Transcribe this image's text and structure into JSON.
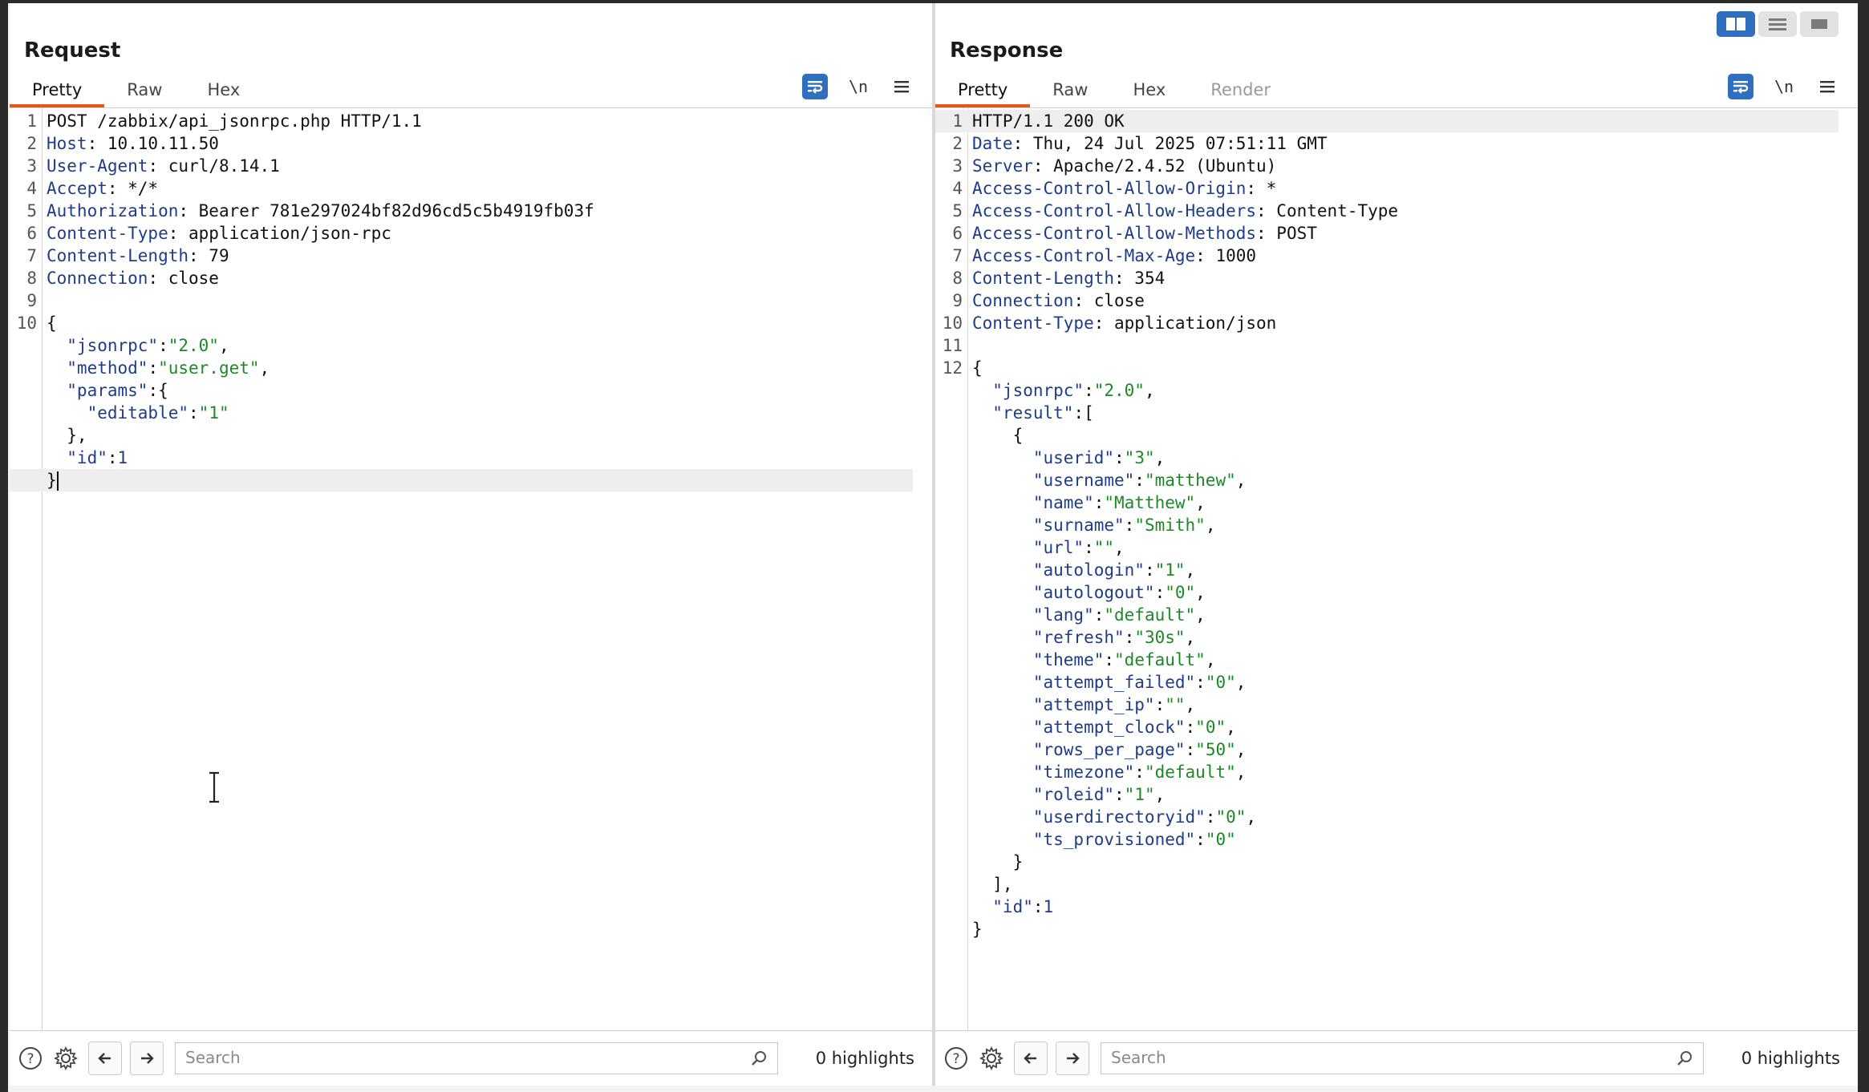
{
  "layout_toggle": [
    "side-by-side",
    "stacked",
    "single"
  ],
  "request": {
    "title": "Request",
    "tabs": [
      {
        "label": "Pretty",
        "active": true
      },
      {
        "label": "Raw",
        "active": false
      },
      {
        "label": "Hex",
        "active": false
      }
    ],
    "tools": {
      "newline_label": "\\n"
    },
    "lines": [
      [
        {
          "t": "POST /zabbix/api_jsonrpc.php HTTP/1.1",
          "c": ""
        }
      ],
      [
        {
          "t": "Host",
          "c": "k"
        },
        {
          "t": ": 10.10.11.50",
          "c": ""
        }
      ],
      [
        {
          "t": "User-Agent",
          "c": "k"
        },
        {
          "t": ": curl/8.14.1",
          "c": ""
        }
      ],
      [
        {
          "t": "Accept",
          "c": "k"
        },
        {
          "t": ": */*",
          "c": ""
        }
      ],
      [
        {
          "t": "Authorization",
          "c": "k"
        },
        {
          "t": ": Bearer 781e297024bf82d96cd5c5b4919fb03f",
          "c": ""
        }
      ],
      [
        {
          "t": "Content-Type",
          "c": "k"
        },
        {
          "t": ": application/json-rpc",
          "c": ""
        }
      ],
      [
        {
          "t": "Content-Length",
          "c": "k"
        },
        {
          "t": ": 79",
          "c": ""
        }
      ],
      [
        {
          "t": "Connection",
          "c": "k"
        },
        {
          "t": ": close",
          "c": ""
        }
      ],
      [],
      [
        {
          "t": "{",
          "c": ""
        }
      ],
      [
        {
          "t": "  \"jsonrpc\"",
          "c": "sk"
        },
        {
          "t": ":",
          "c": ""
        },
        {
          "t": "\"2.0\"",
          "c": "sv"
        },
        {
          "t": ",",
          "c": ""
        }
      ],
      [
        {
          "t": "  \"method\"",
          "c": "sk"
        },
        {
          "t": ":",
          "c": ""
        },
        {
          "t": "\"user.get\"",
          "c": "sv"
        },
        {
          "t": ",",
          "c": ""
        }
      ],
      [
        {
          "t": "  \"params\"",
          "c": "sk"
        },
        {
          "t": ":{",
          "c": ""
        }
      ],
      [
        {
          "t": "    \"editable\"",
          "c": "sk"
        },
        {
          "t": ":",
          "c": ""
        },
        {
          "t": "\"1\"",
          "c": "sv"
        }
      ],
      [
        {
          "t": "  },",
          "c": ""
        }
      ],
      [
        {
          "t": "  \"id\"",
          "c": "sk"
        },
        {
          "t": ":",
          "c": ""
        },
        {
          "t": "1",
          "c": "nv"
        }
      ],
      [
        {
          "t": "}",
          "c": ""
        }
      ]
    ],
    "line_numbers": [
      "1",
      "2",
      "3",
      "4",
      "5",
      "6",
      "7",
      "8",
      "9",
      "10",
      "",
      "",
      "",
      "",
      "",
      "",
      ""
    ],
    "search_placeholder": "Search",
    "highlights": "0 highlights"
  },
  "response": {
    "title": "Response",
    "tabs": [
      {
        "label": "Pretty",
        "active": true
      },
      {
        "label": "Raw",
        "active": false
      },
      {
        "label": "Hex",
        "active": false
      },
      {
        "label": "Render",
        "active": false,
        "disabled": true
      }
    ],
    "tools": {
      "newline_label": "\\n"
    },
    "lines": [
      [
        {
          "t": "HTTP/1.1 200 OK",
          "c": ""
        }
      ],
      [
        {
          "t": "Date",
          "c": "k"
        },
        {
          "t": ": Thu, 24 Jul 2025 07:51:11 GMT",
          "c": ""
        }
      ],
      [
        {
          "t": "Server",
          "c": "k"
        },
        {
          "t": ": Apache/2.4.52 (Ubuntu)",
          "c": ""
        }
      ],
      [
        {
          "t": "Access-Control-Allow-Origin",
          "c": "k"
        },
        {
          "t": ": *",
          "c": ""
        }
      ],
      [
        {
          "t": "Access-Control-Allow-Headers",
          "c": "k"
        },
        {
          "t": ": Content-Type",
          "c": ""
        }
      ],
      [
        {
          "t": "Access-Control-Allow-Methods",
          "c": "k"
        },
        {
          "t": ": POST",
          "c": ""
        }
      ],
      [
        {
          "t": "Access-Control-Max-Age",
          "c": "k"
        },
        {
          "t": ": 1000",
          "c": ""
        }
      ],
      [
        {
          "t": "Content-Length",
          "c": "k"
        },
        {
          "t": ": 354",
          "c": ""
        }
      ],
      [
        {
          "t": "Connection",
          "c": "k"
        },
        {
          "t": ": close",
          "c": ""
        }
      ],
      [
        {
          "t": "Content-Type",
          "c": "k"
        },
        {
          "t": ": application/json",
          "c": ""
        }
      ],
      [],
      [
        {
          "t": "{",
          "c": ""
        }
      ],
      [
        {
          "t": "  \"jsonrpc\"",
          "c": "sk"
        },
        {
          "t": ":",
          "c": ""
        },
        {
          "t": "\"2.0\"",
          "c": "sv"
        },
        {
          "t": ",",
          "c": ""
        }
      ],
      [
        {
          "t": "  \"result\"",
          "c": "sk"
        },
        {
          "t": ":[",
          "c": ""
        }
      ],
      [
        {
          "t": "    {",
          "c": ""
        }
      ],
      [
        {
          "t": "      \"userid\"",
          "c": "sk"
        },
        {
          "t": ":",
          "c": ""
        },
        {
          "t": "\"3\"",
          "c": "sv"
        },
        {
          "t": ",",
          "c": ""
        }
      ],
      [
        {
          "t": "      \"username\"",
          "c": "sk"
        },
        {
          "t": ":",
          "c": ""
        },
        {
          "t": "\"matthew\"",
          "c": "sv"
        },
        {
          "t": ",",
          "c": ""
        }
      ],
      [
        {
          "t": "      \"name\"",
          "c": "sk"
        },
        {
          "t": ":",
          "c": ""
        },
        {
          "t": "\"Matthew\"",
          "c": "sv"
        },
        {
          "t": ",",
          "c": ""
        }
      ],
      [
        {
          "t": "      \"surname\"",
          "c": "sk"
        },
        {
          "t": ":",
          "c": ""
        },
        {
          "t": "\"Smith\"",
          "c": "sv"
        },
        {
          "t": ",",
          "c": ""
        }
      ],
      [
        {
          "t": "      \"url\"",
          "c": "sk"
        },
        {
          "t": ":",
          "c": ""
        },
        {
          "t": "\"\"",
          "c": "sv"
        },
        {
          "t": ",",
          "c": ""
        }
      ],
      [
        {
          "t": "      \"autologin\"",
          "c": "sk"
        },
        {
          "t": ":",
          "c": ""
        },
        {
          "t": "\"1\"",
          "c": "sv"
        },
        {
          "t": ",",
          "c": ""
        }
      ],
      [
        {
          "t": "      \"autologout\"",
          "c": "sk"
        },
        {
          "t": ":",
          "c": ""
        },
        {
          "t": "\"0\"",
          "c": "sv"
        },
        {
          "t": ",",
          "c": ""
        }
      ],
      [
        {
          "t": "      \"lang\"",
          "c": "sk"
        },
        {
          "t": ":",
          "c": ""
        },
        {
          "t": "\"default\"",
          "c": "sv"
        },
        {
          "t": ",",
          "c": ""
        }
      ],
      [
        {
          "t": "      \"refresh\"",
          "c": "sk"
        },
        {
          "t": ":",
          "c": ""
        },
        {
          "t": "\"30s\"",
          "c": "sv"
        },
        {
          "t": ",",
          "c": ""
        }
      ],
      [
        {
          "t": "      \"theme\"",
          "c": "sk"
        },
        {
          "t": ":",
          "c": ""
        },
        {
          "t": "\"default\"",
          "c": "sv"
        },
        {
          "t": ",",
          "c": ""
        }
      ],
      [
        {
          "t": "      \"attempt_failed\"",
          "c": "sk"
        },
        {
          "t": ":",
          "c": ""
        },
        {
          "t": "\"0\"",
          "c": "sv"
        },
        {
          "t": ",",
          "c": ""
        }
      ],
      [
        {
          "t": "      \"attempt_ip\"",
          "c": "sk"
        },
        {
          "t": ":",
          "c": ""
        },
        {
          "t": "\"\"",
          "c": "sv"
        },
        {
          "t": ",",
          "c": ""
        }
      ],
      [
        {
          "t": "      \"attempt_clock\"",
          "c": "sk"
        },
        {
          "t": ":",
          "c": ""
        },
        {
          "t": "\"0\"",
          "c": "sv"
        },
        {
          "t": ",",
          "c": ""
        }
      ],
      [
        {
          "t": "      \"rows_per_page\"",
          "c": "sk"
        },
        {
          "t": ":",
          "c": ""
        },
        {
          "t": "\"50\"",
          "c": "sv"
        },
        {
          "t": ",",
          "c": ""
        }
      ],
      [
        {
          "t": "      \"timezone\"",
          "c": "sk"
        },
        {
          "t": ":",
          "c": ""
        },
        {
          "t": "\"default\"",
          "c": "sv"
        },
        {
          "t": ",",
          "c": ""
        }
      ],
      [
        {
          "t": "      \"roleid\"",
          "c": "sk"
        },
        {
          "t": ":",
          "c": ""
        },
        {
          "t": "\"1\"",
          "c": "sv"
        },
        {
          "t": ",",
          "c": ""
        }
      ],
      [
        {
          "t": "      \"userdirectoryid\"",
          "c": "sk"
        },
        {
          "t": ":",
          "c": ""
        },
        {
          "t": "\"0\"",
          "c": "sv"
        },
        {
          "t": ",",
          "c": ""
        }
      ],
      [
        {
          "t": "      \"ts_provisioned\"",
          "c": "sk"
        },
        {
          "t": ":",
          "c": ""
        },
        {
          "t": "\"0\"",
          "c": "sv"
        }
      ],
      [
        {
          "t": "    }",
          "c": ""
        }
      ],
      [
        {
          "t": "  ],",
          "c": ""
        }
      ],
      [
        {
          "t": "  \"id\"",
          "c": "sk"
        },
        {
          "t": ":",
          "c": ""
        },
        {
          "t": "1",
          "c": "nv"
        }
      ],
      [
        {
          "t": "}",
          "c": ""
        }
      ]
    ],
    "line_numbers": [
      "1",
      "2",
      "3",
      "4",
      "5",
      "6",
      "7",
      "8",
      "9",
      "10",
      "11",
      "12",
      "",
      "",
      "",
      "",
      "",
      "",
      "",
      "",
      "",
      "",
      "",
      "",
      "",
      "",
      "",
      "",
      "",
      "",
      "",
      "",
      "",
      "",
      "",
      "",
      ""
    ],
    "search_placeholder": "Search",
    "highlights": "0 highlights"
  }
}
